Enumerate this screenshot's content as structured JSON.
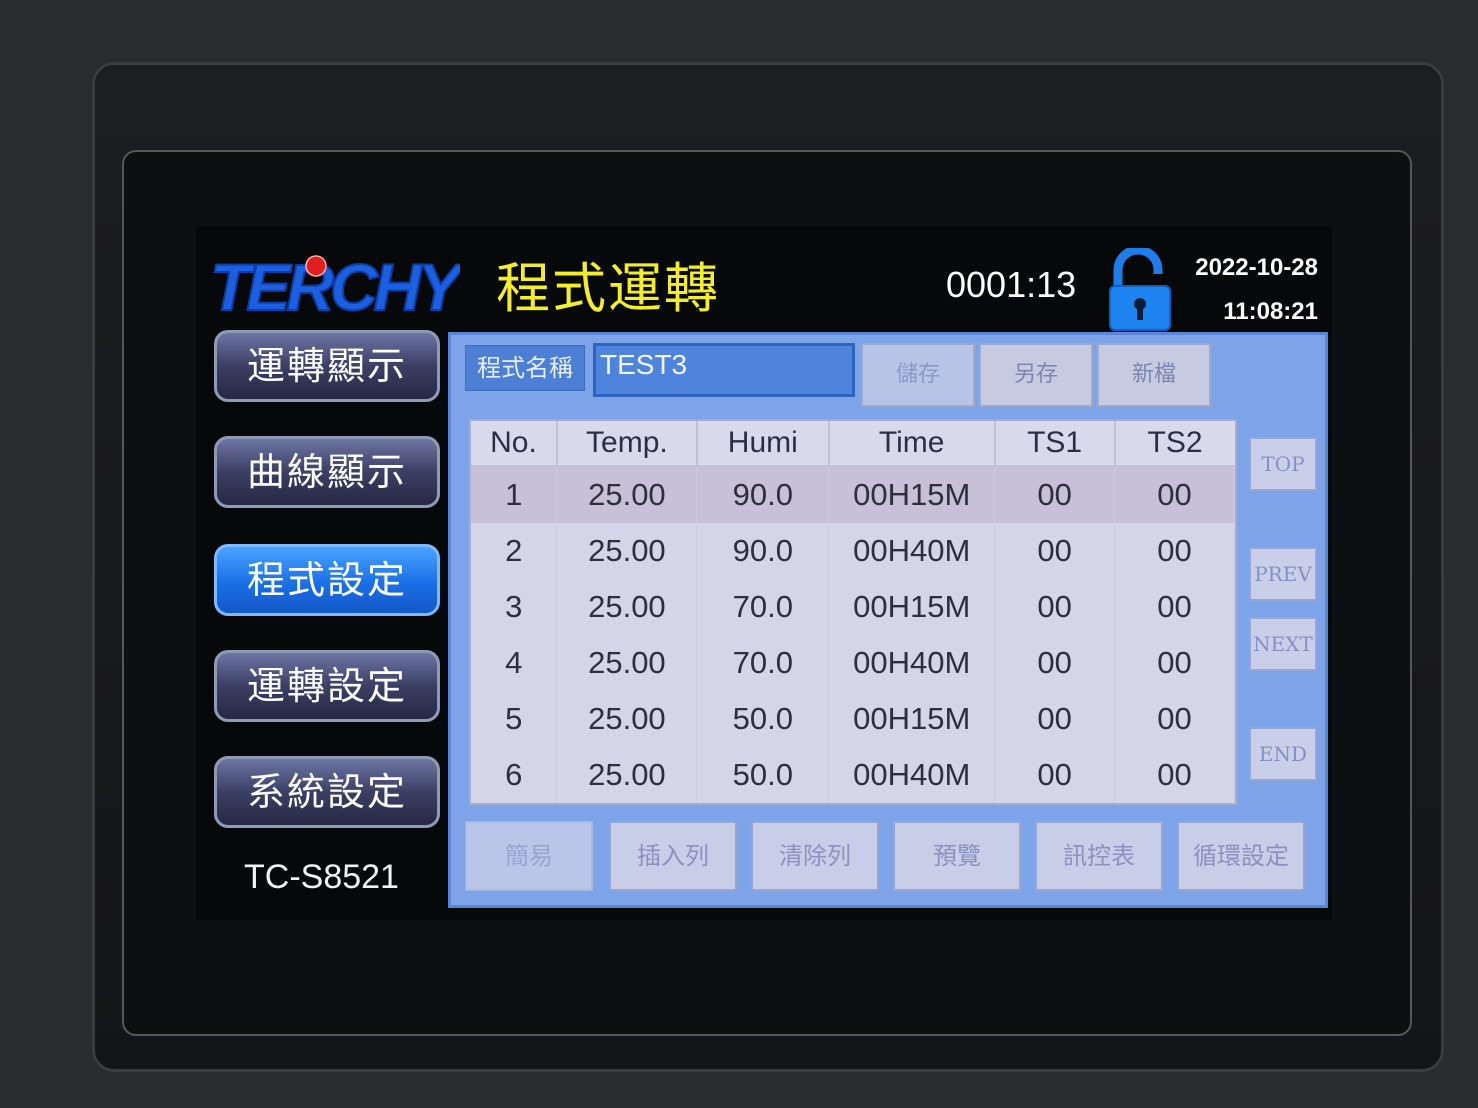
{
  "header": {
    "logo_text": "TERCHY",
    "title": "程式運轉",
    "counter": "0001:13",
    "date": "2022-10-28",
    "time": "11:08:21"
  },
  "nav": {
    "items": [
      {
        "label": "運轉顯示"
      },
      {
        "label": "曲線顯示"
      },
      {
        "label": "程式設定"
      },
      {
        "label": "運轉設定"
      },
      {
        "label": "系統設定"
      }
    ],
    "active_index": 2,
    "model": "TC-S8521"
  },
  "program": {
    "name_label": "程式名稱",
    "name_value": "TEST3",
    "save_label": "儲存",
    "save_as_label": "另存",
    "new_label": "新檔"
  },
  "table": {
    "headers": [
      "No.",
      "Temp.",
      "Humi",
      "Time",
      "TS1",
      "TS2"
    ],
    "rows": [
      [
        "1",
        "25.00",
        "90.0",
        "00H15M",
        "00",
        "00"
      ],
      [
        "2",
        "25.00",
        "90.0",
        "00H40M",
        "00",
        "00"
      ],
      [
        "3",
        "25.00",
        "70.0",
        "00H15M",
        "00",
        "00"
      ],
      [
        "4",
        "25.00",
        "70.0",
        "00H40M",
        "00",
        "00"
      ],
      [
        "5",
        "25.00",
        "50.0",
        "00H15M",
        "00",
        "00"
      ],
      [
        "6",
        "25.00",
        "50.0",
        "00H40M",
        "00",
        "00"
      ]
    ]
  },
  "side_buttons": {
    "top": "TOP",
    "prev": "PREV",
    "next": "NEXT",
    "end": "END"
  },
  "bottom_buttons": {
    "simple": "簡易",
    "insert_row": "插入列",
    "clear_row": "清除列",
    "preview": "預覽",
    "signal_table": "訊控表",
    "loop_setting": "循環設定"
  },
  "colors": {
    "title": "#f2ef2a",
    "panel": "#7da3e8",
    "nav_active": "#1b6fe6"
  }
}
